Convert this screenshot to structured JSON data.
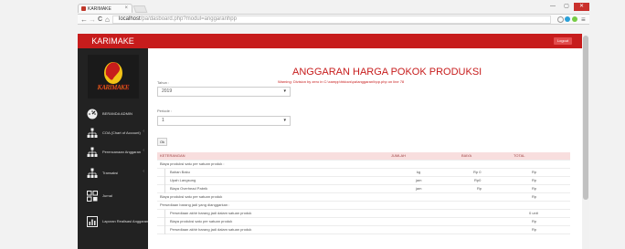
{
  "browser": {
    "tab_title": "KARIMAKE",
    "tab_close": "×",
    "url_host": "localhost",
    "url_path": "/pa/dasboard.php?modul=anggaranhpp",
    "back": "←",
    "forward": "→",
    "reload": "C",
    "home": "⌂",
    "win_min": "—",
    "win_max": "▢",
    "win_close": "✕",
    "menu_icon": "≡"
  },
  "app": {
    "brand": "KARIMAKE",
    "logo_text": "KARIMAKE",
    "logout_label": "Logout"
  },
  "sidebar": {
    "items": [
      {
        "label": "BERANDA ADMIN",
        "icon": "dashboard-icon"
      },
      {
        "label": "COA (Chart of Account)",
        "icon": "sitemap-icon"
      },
      {
        "label": "Perencanaan Anggaran",
        "icon": "sitemap-icon"
      },
      {
        "label": "Transaksi",
        "icon": "sitemap-icon"
      },
      {
        "label": "Jurnal",
        "icon": "grid-icon"
      },
      {
        "label": "Laporan Realisasi Anggaran",
        "icon": "bar-chart-icon"
      }
    ]
  },
  "page": {
    "title": "ANGGARAN HARGA POKOK PRODUKSI",
    "warning": "Warning: Division by zero in C:\\xampp\\htdocs\\pa\\anggaran\\hpp.php on line 78",
    "tahun_label": "Tahun :",
    "tahun_value": "2019",
    "periode_label": "Periode :",
    "periode_value": "1",
    "ok_label": "Ok"
  },
  "table": {
    "headers": [
      "KETERANGAN",
      "JUMLAH",
      "BIAYA",
      "TOTAL"
    ],
    "rows": [
      {
        "ket": "Biaya produksi satu per satuan produk :",
        "jumlah": "",
        "biaya": "",
        "total": ""
      },
      {
        "ket": "Bahan Baku",
        "jumlah": "kg",
        "biaya": "Rp 0",
        "total": "Rp"
      },
      {
        "ket": "Upah Langsung",
        "jumlah": "jam",
        "biaya": "Rp0",
        "total": "Rp"
      },
      {
        "ket": "Biaya Overhead Pabrik",
        "jumlah": "jam",
        "biaya": "Rp",
        "total": "Rp"
      },
      {
        "ket": "Biaya produksi satu per satuan produk",
        "jumlah": "",
        "biaya": "",
        "total": "Rp"
      },
      {
        "ket": "Persediaan barang jadi yang dianggarkan :",
        "jumlah": "",
        "biaya": "",
        "total": ""
      },
      {
        "ket": "Persediaan akhir barang jadi dalam satuan produk",
        "jumlah": "",
        "biaya": "",
        "total": "0 unit"
      },
      {
        "ket": "Biaya produksi satu per satuan produk",
        "jumlah": "",
        "biaya": "",
        "total": "Rp"
      },
      {
        "ket": "Persediaan akhir barang jadi dalam satuan produk",
        "jumlah": "",
        "biaya": "",
        "total": "Rp"
      }
    ]
  },
  "colors": {
    "brand": "#c71c1c",
    "sidebar": "#222222",
    "table_header": "#f8dede"
  }
}
